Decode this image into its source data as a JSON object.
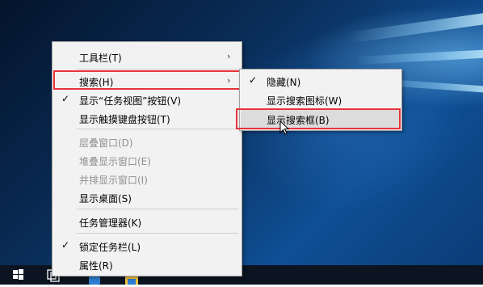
{
  "context_menu": {
    "toolbars": "工具栏(T)",
    "search": "搜索(H)",
    "show_task_view": "显示“任务视图”按钮(V)",
    "show_touch_keyboard": "显示触摸键盘按钮(T)",
    "cascade": "层叠窗口(D)",
    "stacked": "堆叠显示窗口(E)",
    "side_by_side": "并排显示窗口(I)",
    "show_desktop": "显示桌面(S)",
    "task_manager": "任务管理器(K)",
    "lock_taskbar": "锁定任务栏(L)",
    "properties": "属性(R)"
  },
  "submenu": {
    "hidden": "隐藏(N)",
    "show_search_icon": "显示搜索图标(W)",
    "show_search_box": "显示搜索框(B)"
  },
  "icons": {
    "check": "✓",
    "arrow": "›"
  },
  "colors": {
    "highlight_border": "#e8333a",
    "menu_bg": "#f2f2f2"
  }
}
